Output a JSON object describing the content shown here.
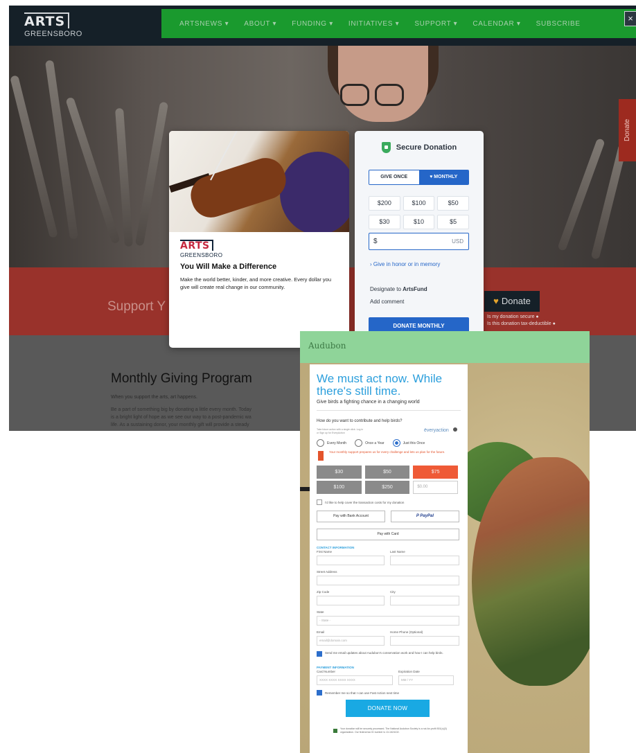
{
  "arts": {
    "logo_big": "ARTS",
    "logo_small": "GREENSBORO",
    "nav": [
      "ARTSNEWS ▾",
      "ABOUT ▾",
      "FUNDING ▾",
      "INITIATIVES ▾",
      "SUPPORT ▾",
      "CALENDAR ▾",
      "SUBSCRIBE"
    ],
    "close": "×",
    "side_tab": "Donate",
    "support_title": "Support Y",
    "donate_button": "Donate",
    "faq1": "Is my donation secure",
    "faq2": "Is this donation tax-deductible",
    "monthly_title": "Monthly Giving Program",
    "monthly_lead": "When you support the arts, art happens.",
    "para1": "Be a part of something big by donating a little every month. Today",
    "para2": "is a bright light of hope as we see our way to a post-pandemic wa",
    "para3": "life. As a sustaining donor, your monthly gift will provide a steady"
  },
  "popup": {
    "logo_big": "ARTS",
    "logo_small": "GREENSBORO",
    "heading": "You Will Make a Difference",
    "body": "Make the world better, kinder, and more creative. Every dollar you give will create real change in our community."
  },
  "donation": {
    "title": "Secure Donation",
    "give_once": "GIVE ONCE",
    "monthly": "♥ MONTHLY",
    "amounts": [
      "$200",
      "$100",
      "$50",
      "$30",
      "$10",
      "$5"
    ],
    "currency_symbol": "$",
    "currency_code": "USD",
    "honor_link": "› Give in honor or in memory",
    "designate_prefix": "Designate to ",
    "designate_fund": "ArtsFund",
    "add_comment": "Add comment",
    "donate_button": "DONATE MONTHLY"
  },
  "audubon": {
    "logo": "Audubon",
    "headline": "We must act now. While there's still time.",
    "subhead": "Give birds a fighting chance in a changing world",
    "question": "How do you want to contribute and help birds?",
    "tiny_note": "Take future action with a single click. Log in or Sign up for EveryAction",
    "edonation": "ëveryaction",
    "freq": [
      "Every Month",
      "Once a Year",
      "Just this Once"
    ],
    "monthly_note": "Your monthly support prepares us for every challenge and lets us plan for the future.",
    "amounts": [
      "$30",
      "$50",
      "$75",
      "$100",
      "$250"
    ],
    "other_placeholder": "$0.00",
    "fees_note": "I'd like to help cover the transaction costs for my donation",
    "bank_btn": "Pay with Bank Account",
    "paypal_btn": "P PayPal",
    "card_btn": "Pay with Card",
    "contact_section": "CONTACT INFORMATION",
    "first_name": "First Name",
    "last_name": "Last Name",
    "street": "Street Address",
    "zip": "Zip Code",
    "city": "City",
    "state": "State",
    "state_value": "- State -",
    "email": "Email",
    "email_placeholder": "email@domain.com",
    "phone": "Home Phone (Optional)",
    "updates": "Send me email updates about Audubon's conservation work and how I can help birds.",
    "payment_section": "PAYMENT INFORMATION",
    "card_number": "Card Number",
    "card_placeholder": "XXXX XXXX XXXX XXXX",
    "expiration": "Expiration Date",
    "exp_placeholder": "MM / YY",
    "remember": "Remember me so that I can use Fast Action next time",
    "donate_now": "DONATE NOW",
    "footer": "Your donation will be securely processed. The National Audubon Society is a not-for-profit 501(c)(3) organization. Our federal tax ID number is 13-1624102."
  }
}
